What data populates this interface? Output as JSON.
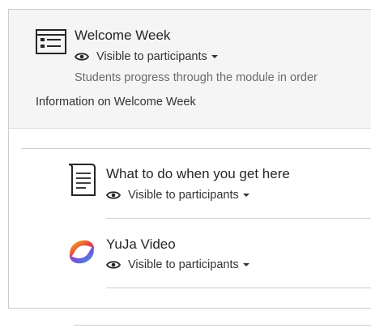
{
  "module": {
    "title": "Welcome Week",
    "visibility": "Visible to participants",
    "description": "Students progress through the module in order",
    "info": "Information on Welcome Week"
  },
  "items": [
    {
      "title": "What to do when you get here",
      "visibility": "Visible to participants",
      "icon": "document-icon"
    },
    {
      "title": "YuJa Video",
      "visibility": "Visible to participants",
      "icon": "yuja-logo"
    }
  ]
}
